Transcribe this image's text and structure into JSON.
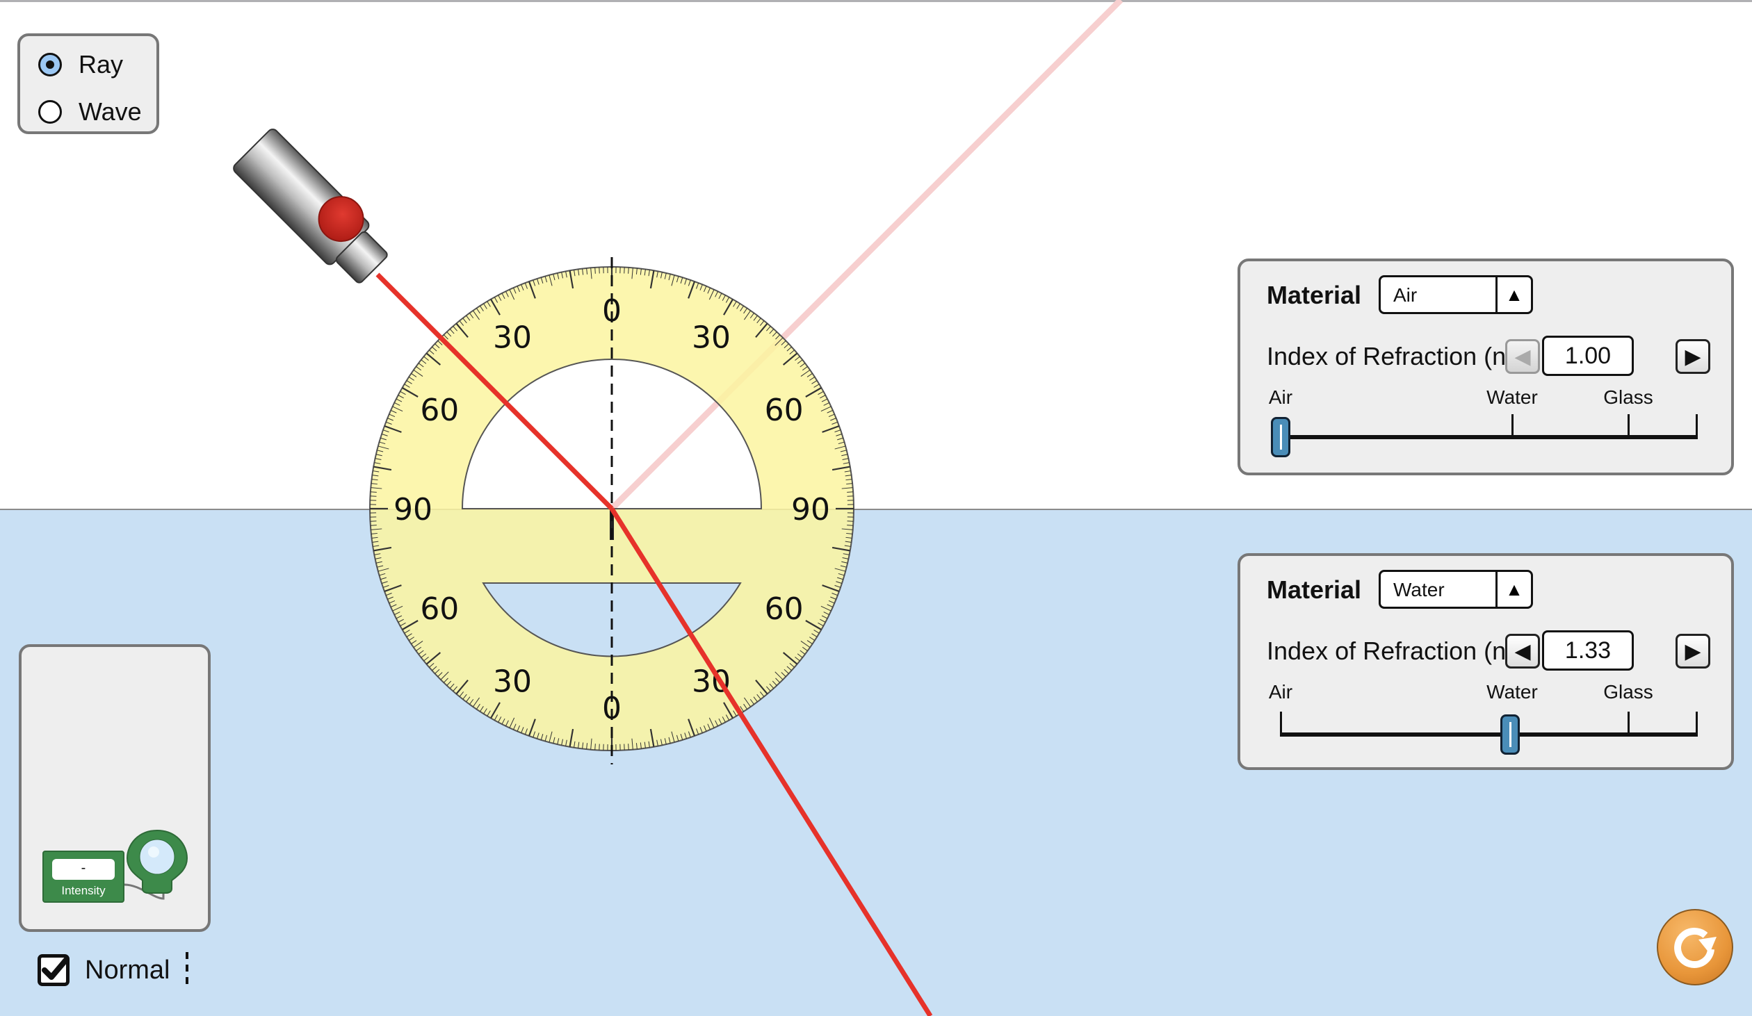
{
  "mode": {
    "options": [
      {
        "label": "Ray",
        "selected": true
      },
      {
        "label": "Wave",
        "selected": false
      }
    ]
  },
  "top_medium": {
    "material_label": "Material",
    "material_value": "Air",
    "ior_label": "Index of Refraction (n)",
    "ior_value": "1.00",
    "ior_numeric": 1.0,
    "decrease_enabled": false,
    "increase_enabled": true,
    "slider_labels": [
      "Air",
      "Water",
      "Glass"
    ]
  },
  "bottom_medium": {
    "material_label": "Material",
    "material_value": "Water",
    "ior_label": "Index of Refraction (n)",
    "ior_value": "1.33",
    "ior_numeric": 1.33,
    "decrease_enabled": true,
    "increase_enabled": true,
    "slider_labels": [
      "Air",
      "Water",
      "Glass"
    ]
  },
  "slider_scale": {
    "min": 1.0,
    "max": 1.6,
    "marks": [
      1.0,
      1.33,
      1.5
    ]
  },
  "intensity_meter": {
    "reading": "-",
    "label": "Intensity"
  },
  "normal_checkbox": {
    "label": "Normal",
    "checked": true
  },
  "protractor": {
    "labels_upper": [
      "90",
      "60",
      "30",
      "0",
      "30",
      "60",
      "90"
    ],
    "labels_lower": [
      "60",
      "30",
      "0",
      "30",
      "60"
    ]
  },
  "laser": {
    "incident_angle_deg": 45,
    "on": true
  },
  "colors": {
    "beam": "#e6322a",
    "reflected_beam": "#f7cfcf",
    "water": "#c9e0f4",
    "protractor": "#fbf4a0",
    "slider_thumb": "#4a8db8",
    "reset": "#e8963a",
    "detector": "#3d8a4a"
  },
  "icons": {
    "reset": "reset-icon",
    "combo_arrow": "▲",
    "step_left": "◀",
    "step_right": "▶"
  }
}
